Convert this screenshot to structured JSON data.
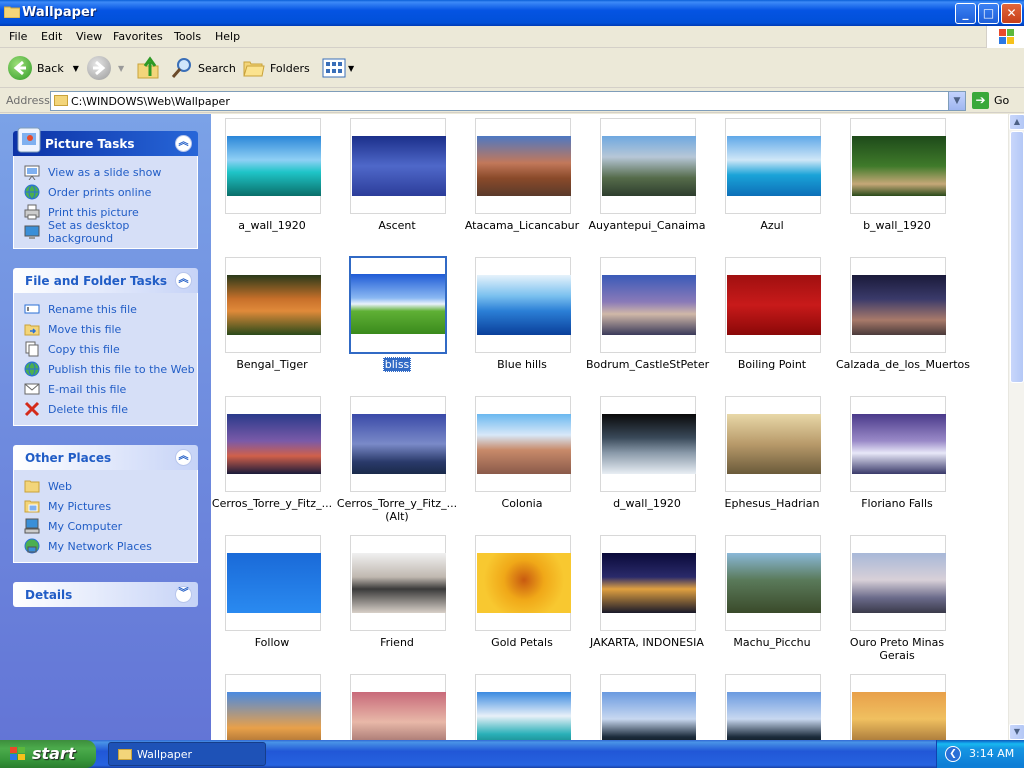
{
  "window": {
    "title": "Wallpaper",
    "controls": {
      "minimize": "_",
      "maximize": "□",
      "close": "✕"
    }
  },
  "menu": [
    "File",
    "Edit",
    "View",
    "Favorites",
    "Tools",
    "Help"
  ],
  "toolbar": {
    "back": "Back",
    "search": "Search",
    "folders": "Folders"
  },
  "address": {
    "label": "Address",
    "path": "C:\\WINDOWS\\Web\\Wallpaper",
    "go": "Go"
  },
  "panels": {
    "picture_tasks": {
      "title": "Picture Tasks",
      "items": [
        "View as a slide show",
        "Order prints online",
        "Print this picture",
        "Set as desktop background"
      ]
    },
    "file_folder_tasks": {
      "title": "File and Folder Tasks",
      "items": [
        "Rename this file",
        "Move this file",
        "Copy this file",
        "Publish this file to the Web",
        "E-mail this file",
        "Delete this file"
      ]
    },
    "other_places": {
      "title": "Other Places",
      "items": [
        "Web",
        "My Pictures",
        "My Computer",
        "My Network Places"
      ]
    },
    "details": {
      "title": "Details"
    }
  },
  "thumbnails": [
    "a_wall_1920",
    "Ascent",
    "Atacama_Licancabur",
    "Auyantepui_Canaima",
    "Azul",
    "b_wall_1920",
    "Bengal_Tiger",
    "bliss",
    "Blue hills",
    "Bodrum_CastleStPeter",
    "Boiling Point",
    "Calzada_de_los_Muertos",
    "Cerros_Torre_y_Fitz_...",
    "Cerros_Torre_y_Fitz_... (Alt)",
    "Colonia",
    "d_wall_1920",
    "Ephesus_Hadrian",
    "Floriano Falls",
    "Follow",
    "Friend",
    "Gold Petals",
    "JAKARTA, INDONESIA",
    "Machu_Picchu",
    "Ouro Preto Minas Gerais",
    "",
    "",
    "",
    "",
    "",
    ""
  ],
  "selected_thumbnail": "bliss",
  "taskbar": {
    "start": "start",
    "window_button": "Wallpaper",
    "clock": "3:14 AM"
  }
}
